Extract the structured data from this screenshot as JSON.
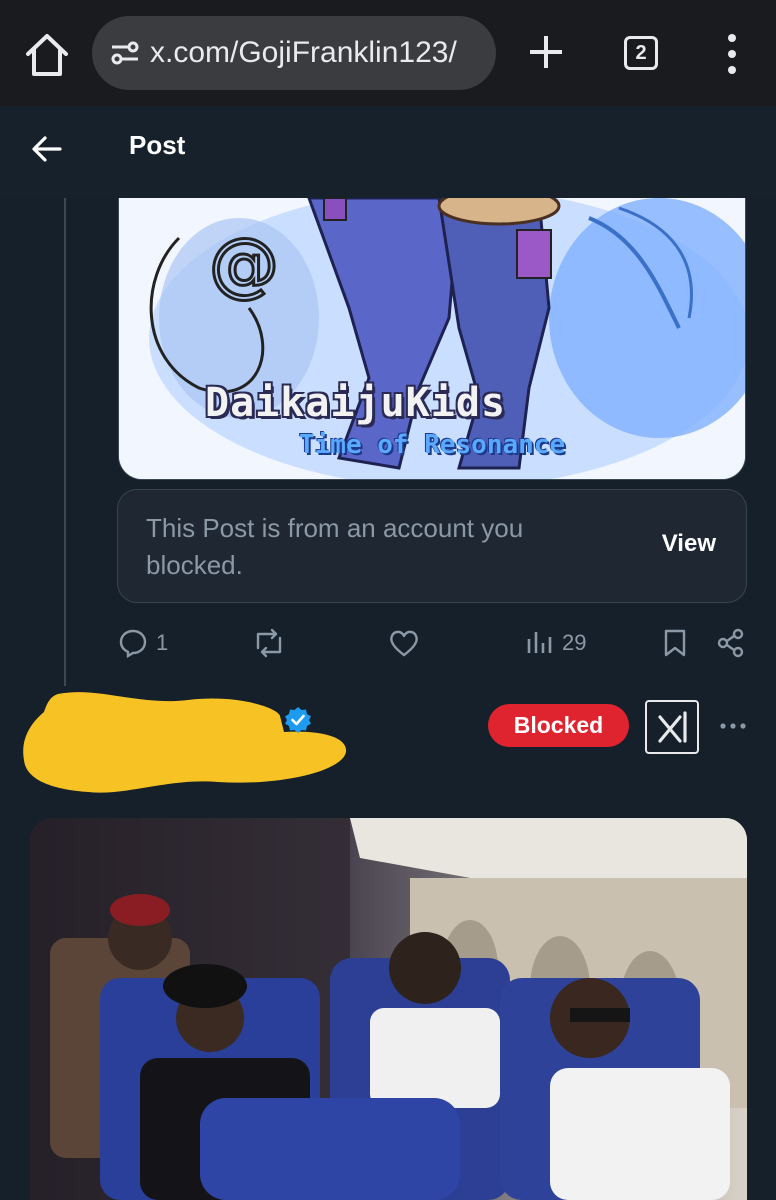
{
  "browser": {
    "url": "x.com/GojiFranklin123/",
    "tab_count": "2"
  },
  "header": {
    "title": "Post"
  },
  "quoted_post": {
    "art_title": "DaikaijuKids",
    "art_subtitle": "Time of Resonance",
    "blocked_notice": "This Post is from an account you blocked.",
    "view_label": "View"
  },
  "actions": {
    "replies": "1",
    "views": "29"
  },
  "reply_post": {
    "handle_prefix": "@",
    "blocked_label": "Blocked",
    "more_label": "···"
  },
  "colors": {
    "background": "#15202b",
    "blocked_badge": "#e0242f",
    "verified": "#1d9bf0",
    "muted": "#8b98a5",
    "scribble": "#f7c324"
  }
}
